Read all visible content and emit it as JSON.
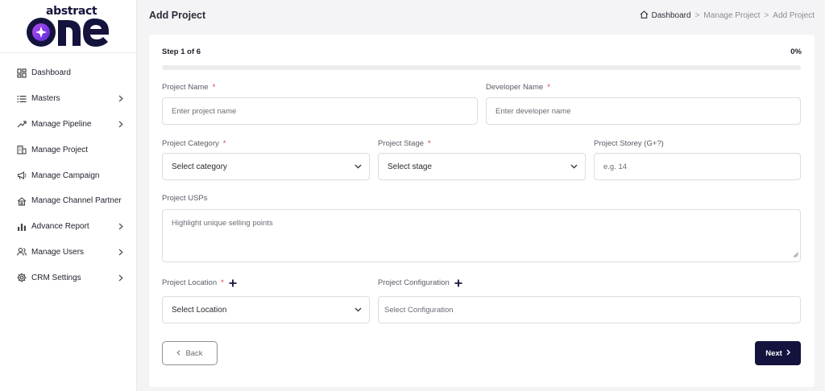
{
  "brand": {
    "top_text": "abstract",
    "main_text": "one"
  },
  "sidebar": {
    "items": [
      {
        "label": "Dashboard",
        "icon": "dashboard-grid-icon",
        "has_submenu": false
      },
      {
        "label": "Masters",
        "icon": "list-icon",
        "has_submenu": true
      },
      {
        "label": "Manage Pipeline",
        "icon": "pipeline-icon",
        "has_submenu": true
      },
      {
        "label": "Manage Project",
        "icon": "building-icon",
        "has_submenu": false
      },
      {
        "label": "Manage Campaign",
        "icon": "megaphone-icon",
        "has_submenu": false
      },
      {
        "label": "Manage Channel Partner",
        "icon": "partner-icon",
        "has_submenu": false
      },
      {
        "label": "Advance Report",
        "icon": "bar-chart-icon",
        "has_submenu": true
      },
      {
        "label": "Manage Users",
        "icon": "users-icon",
        "has_submenu": true
      },
      {
        "label": "CRM Settings",
        "icon": "gear-icon",
        "has_submenu": true
      }
    ]
  },
  "header": {
    "title": "Add Project",
    "breadcrumb": [
      "Dashboard",
      "Manage Project",
      "Add Project"
    ],
    "separator": ">"
  },
  "progress": {
    "step_text": "Step 1 of 6",
    "percent_text": "0%",
    "fraction": 0
  },
  "form": {
    "project_name": {
      "label": "Project Name",
      "required": "*",
      "placeholder": "Enter project name"
    },
    "developer_name": {
      "label": "Developer Name",
      "required": "*",
      "placeholder": "Enter developer name"
    },
    "project_category": {
      "label": "Project Category",
      "required": "*",
      "value": "Select category"
    },
    "project_stage": {
      "label": "Project Stage",
      "required": "*",
      "value": "Select stage"
    },
    "project_storey": {
      "label": "Project Storey (G+?)",
      "placeholder": "e.g. 14"
    },
    "project_usps": {
      "label": "Project USPs",
      "placeholder": "Highlight unique selling points"
    },
    "project_location": {
      "label": "Project Location",
      "required": "*",
      "value": "Select Location"
    },
    "project_configuration": {
      "label": "Project Configuration",
      "placeholder": "Select Configuration"
    }
  },
  "buttons": {
    "back": "Back",
    "next": "Next"
  },
  "colors": {
    "brand": "#14133d",
    "required": "#e0364a",
    "logo_accent": "#8b3fe6"
  }
}
